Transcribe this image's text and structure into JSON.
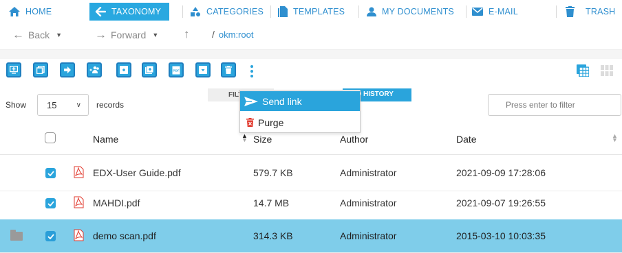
{
  "nav": {
    "items": [
      {
        "label": "HOME",
        "icon": "home-icon"
      },
      {
        "label": "TAXONOMY",
        "icon": "taxonomy-icon",
        "active": true
      },
      {
        "label": "CATEGORIES",
        "icon": "categories-icon"
      },
      {
        "label": "TEMPLATES",
        "icon": "templates-icon"
      },
      {
        "label": "MY DOCUMENTS",
        "icon": "user-icon"
      },
      {
        "label": "E-MAIL",
        "icon": "mail-icon"
      },
      {
        "label": "TRASH",
        "icon": "trash-icon"
      }
    ]
  },
  "pathbar": {
    "back_label": "Back",
    "forward_label": "Forward",
    "path_separator": "/",
    "path": "okm:root"
  },
  "toolbar": {
    "buttons": [
      "add-document-icon",
      "copy-icon",
      "move-icon",
      "add-users-icon",
      "add-icon",
      "add-folder-icon",
      "pdf-icon",
      "download-icon",
      "delete-icon"
    ],
    "more_icon": "more-vertical-icon",
    "right_icons": [
      "table-view-icon",
      "grid-view-icon"
    ]
  },
  "tabs": {
    "filter": "FILT",
    "history": "HISTORY"
  },
  "dropdown": {
    "items": [
      {
        "label": "Send link",
        "icon": "send-icon",
        "highlighted": true
      },
      {
        "label": "Purge",
        "icon": "purge-icon"
      }
    ]
  },
  "records": {
    "show_label": "Show",
    "page_size": "15",
    "records_label": "records",
    "filter_placeholder": "Press enter to filter"
  },
  "table": {
    "headers": {
      "name": "Name",
      "size": "Size",
      "author": "Author",
      "date": "Date"
    },
    "rows": [
      {
        "name": "EDX-User Guide.pdf",
        "size": "579.7 KB",
        "author": "Administrator",
        "date": "2021-09-09 17:28:06",
        "checked": true,
        "selected": false
      },
      {
        "name": "MAHDI.pdf",
        "size": "14.7 MB",
        "author": "Administrator",
        "date": "2021-09-07 19:26:55",
        "checked": true,
        "selected": false
      },
      {
        "name": "demo scan.pdf",
        "size": "314.3 KB",
        "author": "Administrator",
        "date": "2015-03-10 10:03:35",
        "checked": true,
        "selected": true
      }
    ]
  },
  "colors": {
    "accent": "#2aa4dc",
    "selected_row": "#7fcdea",
    "link": "#2f8fcf",
    "pdf_red": "#e1382c"
  }
}
